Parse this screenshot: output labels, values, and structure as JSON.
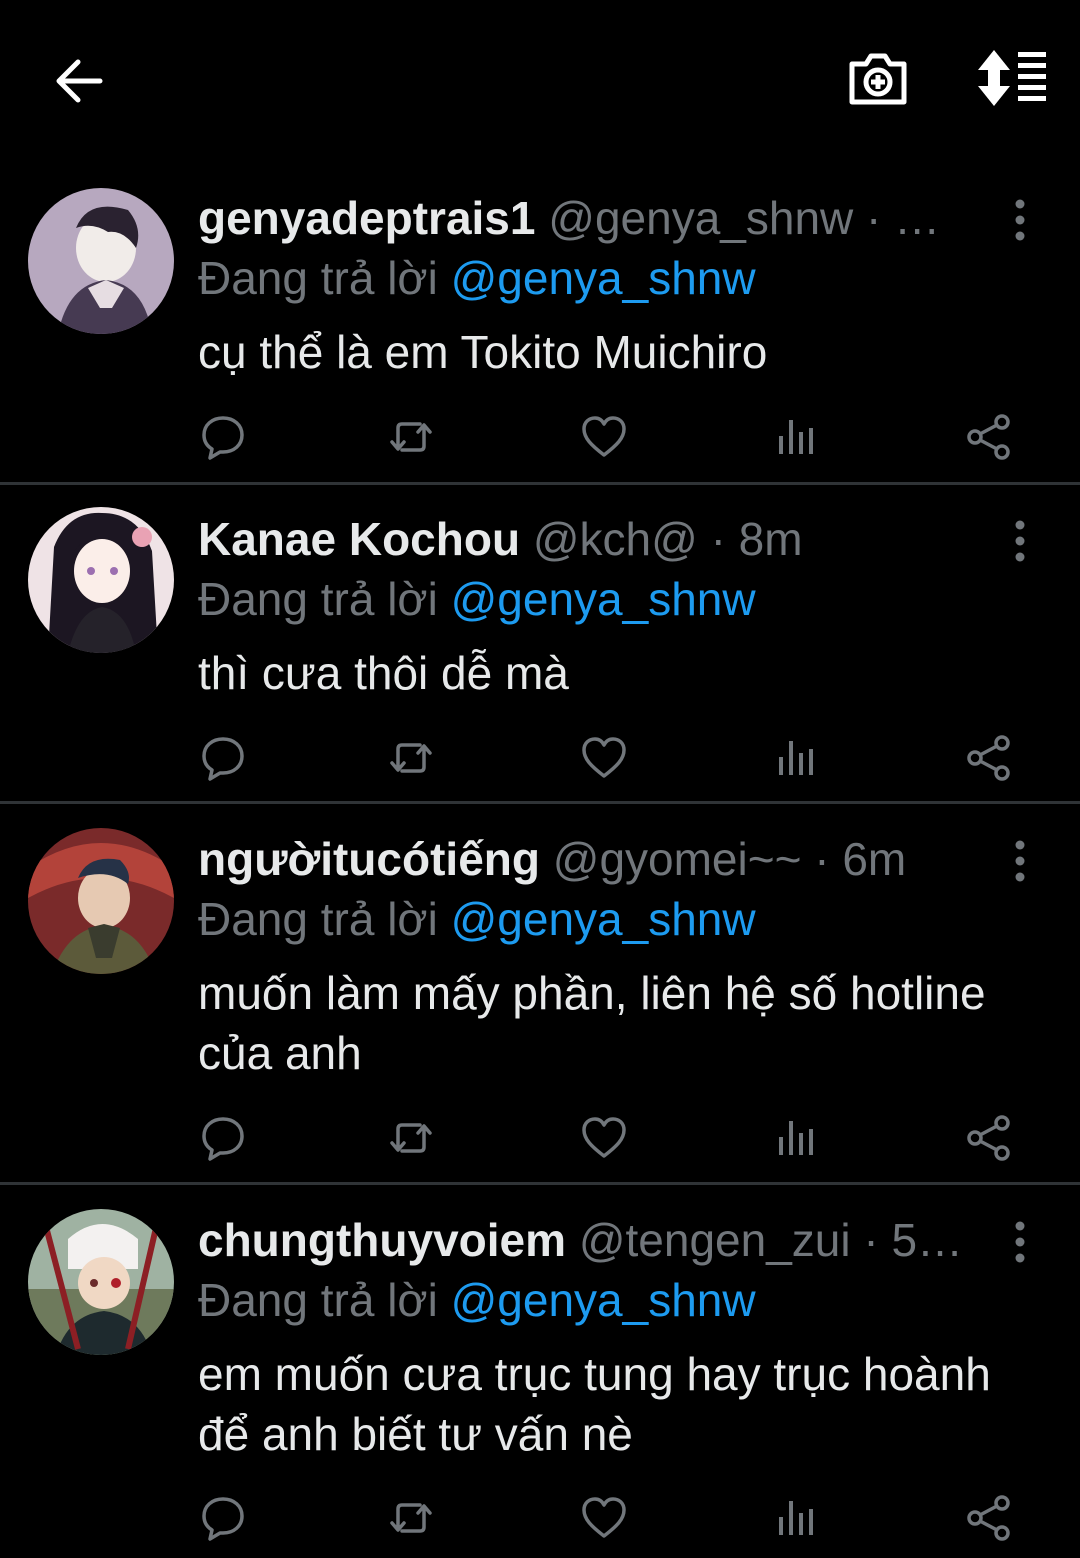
{
  "colors": {
    "background": "#000000",
    "text": "#e7e9ea",
    "secondary": "#71767b",
    "mention": "#1d9bf0",
    "divider": "#2f3336"
  },
  "topbar": {
    "back_icon": "arrow-left-icon",
    "camera_icon": "camera-plus-icon",
    "sort_icon": "sort-icon"
  },
  "tweets": [
    {
      "name": "genyadeptrais1",
      "handle_meta": "@genya_shnw · …",
      "reply_prefix": "Đang trả lời",
      "reply_to": "@genya_shnw",
      "text": "cụ thể là em Tokito Muichiro"
    },
    {
      "name": "Kanae Kochou",
      "handle_meta": "@kch@ · 8m",
      "reply_prefix": "Đang trả lời",
      "reply_to": "@genya_shnw",
      "text": "thì cưa thôi dễ mà"
    },
    {
      "name": "ngườitucótiếng",
      "handle_meta": "@gyomei~~ · 6m",
      "reply_prefix": "Đang trả lời",
      "reply_to": "@genya_shnw",
      "text": "muốn làm mấy phần, liên hệ số hotline của anh"
    },
    {
      "name": "chungthuyvoiem",
      "handle_meta": "@tengen_zui · 5…",
      "reply_prefix": "Đang trả lời",
      "reply_to": "@genya_shnw",
      "text": "em muốn cưa trục tung hay trục hoành để anh biết tư vấn nè"
    }
  ],
  "action_icons": [
    "reply-icon",
    "retweet-icon",
    "like-icon",
    "views-icon",
    "share-icon"
  ]
}
